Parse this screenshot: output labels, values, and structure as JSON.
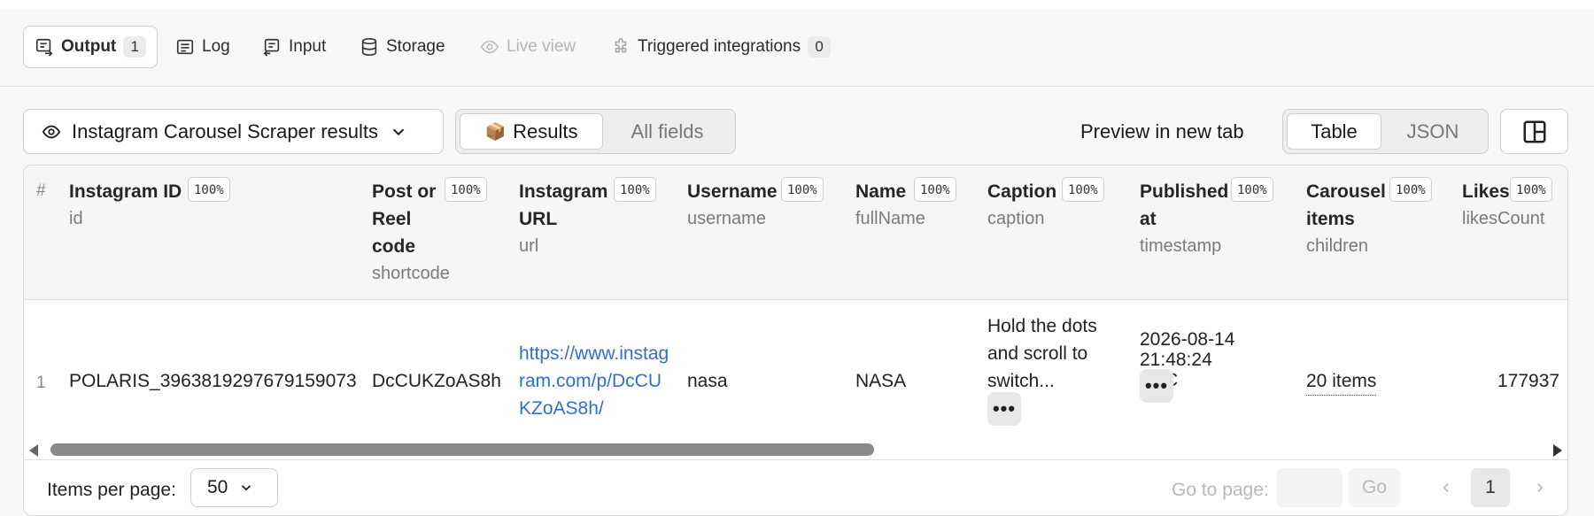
{
  "tabs": [
    {
      "label": "Output",
      "count": "1"
    },
    {
      "label": "Log"
    },
    {
      "label": "Input"
    },
    {
      "label": "Storage"
    },
    {
      "label": "Live view"
    },
    {
      "label": "Triggered integrations",
      "count": "0"
    }
  ],
  "toolbar": {
    "dataset": "Instagram Carousel Scraper results",
    "view_results_icon": "📦",
    "view_results": "Results",
    "view_all_fields": "All fields",
    "preview": "Preview in new tab",
    "format_table": "Table",
    "format_json": "JSON"
  },
  "table": {
    "hash": "#",
    "pct": "100%",
    "columns": [
      {
        "title": "Instagram ID",
        "field": "id"
      },
      {
        "title": "Post or Reel code",
        "field": "shortcode"
      },
      {
        "title": "Instagram URL",
        "field": "url"
      },
      {
        "title": "Username",
        "field": "username"
      },
      {
        "title": "Name",
        "field": "fullName"
      },
      {
        "title": "Caption",
        "field": "caption"
      },
      {
        "title": "Published at",
        "field": "timestamp"
      },
      {
        "title": "Carousel items",
        "field": "children"
      },
      {
        "title": "Likes",
        "field": "likesCount"
      }
    ],
    "row": {
      "index": "1",
      "id": "POLARIS_3963819297679159073",
      "shortcode": "DcCUKZoAS8h",
      "url": "https://www.instagram.com/p/DcCUKZoAS8h/",
      "username": "nasa",
      "fullName": "NASA",
      "caption": "Hold the dots and scroll to switch...",
      "timestamp": "2026-08-14 21:48:24 UTC",
      "children": "20 items",
      "likesCount": "177937",
      "more": "•••"
    }
  },
  "pagination": {
    "items_per_page_label": "Items per page:",
    "items_per_page": "50",
    "go_to_label": "Go to page:",
    "go": "Go",
    "page": "1"
  }
}
